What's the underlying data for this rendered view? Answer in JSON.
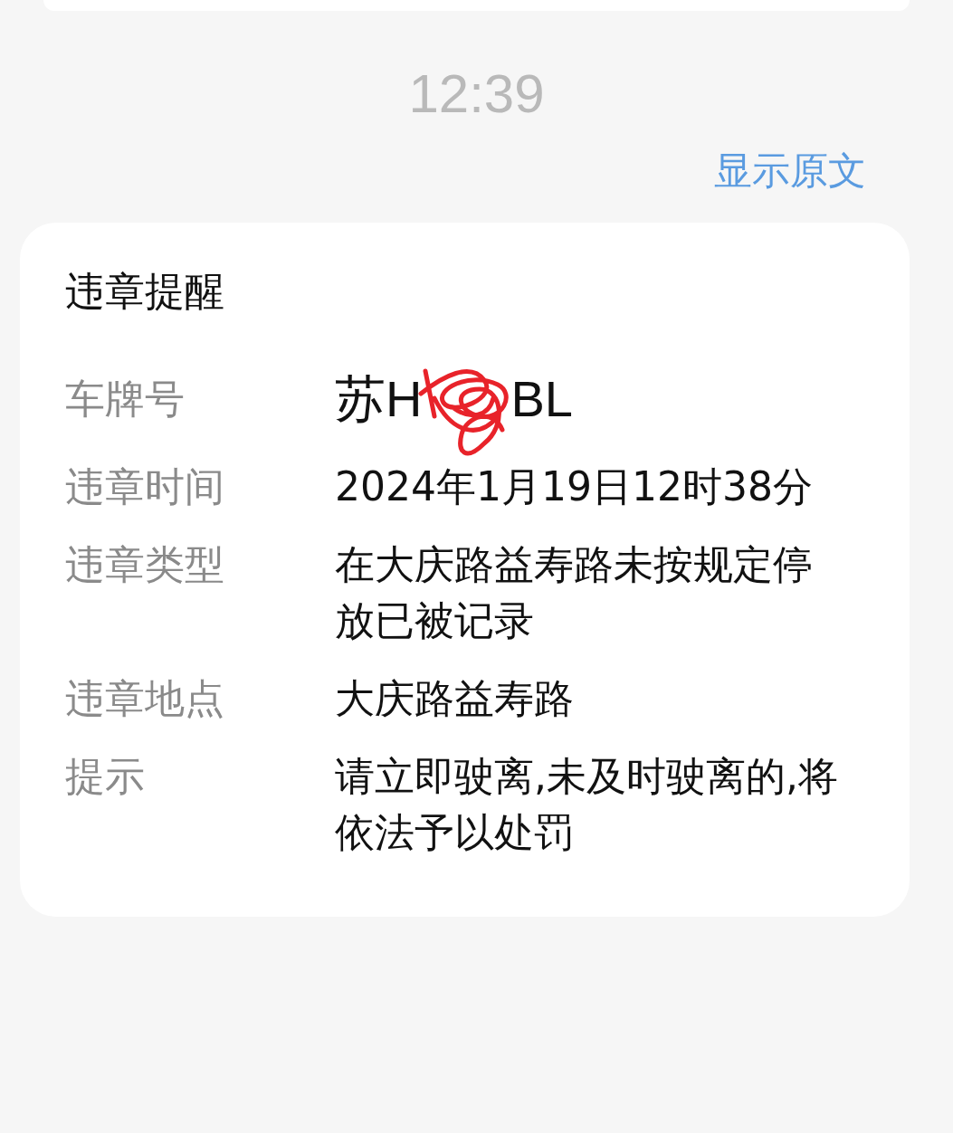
{
  "time": "12:39",
  "show_original_link": "显示原文",
  "card": {
    "title": "违章提醒",
    "rows": [
      {
        "kind": "plate",
        "label": "车牌号",
        "value_start": "苏H",
        "value_end": "BL"
      },
      {
        "kind": "text",
        "label": "违章时间",
        "value": "2024年1月19日12时38分"
      },
      {
        "kind": "text",
        "label": "违章类型",
        "value": "在大庆路益寿路未按规定停放已被记录"
      },
      {
        "kind": "text",
        "label": "违章地点",
        "value": "大庆路益寿路"
      },
      {
        "kind": "text",
        "label": "提示",
        "value": "请立即驶离,未及时驶离的,将依法予以处罚"
      }
    ]
  }
}
